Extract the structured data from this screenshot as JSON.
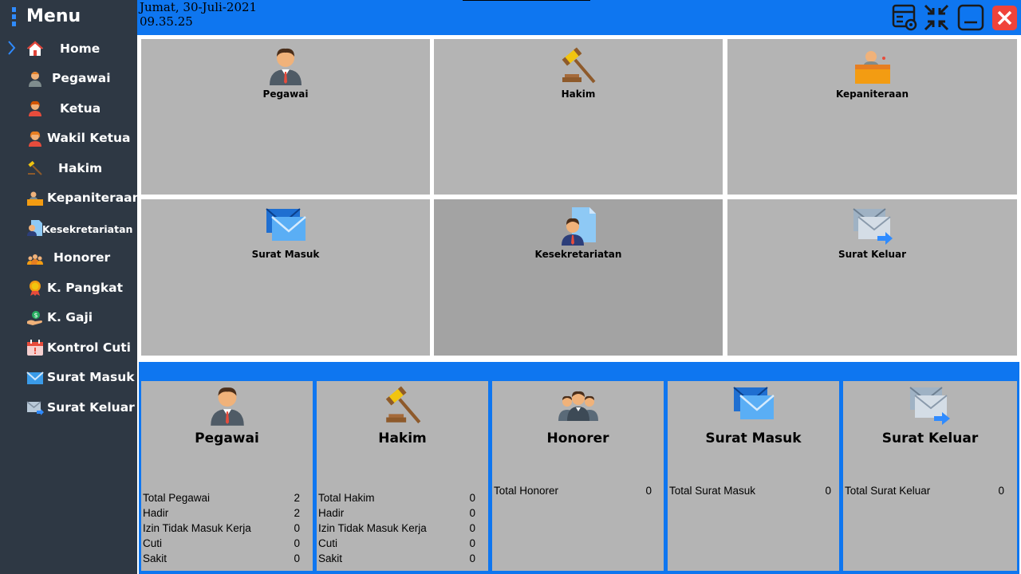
{
  "sidebar": {
    "title": "Menu",
    "items": [
      {
        "label": "Home",
        "icon": "home-icon",
        "selected": true
      },
      {
        "label": "Pegawai",
        "icon": "employee-icon"
      },
      {
        "label": "Ketua",
        "icon": "chairman-icon"
      },
      {
        "label": "Wakil Ketua",
        "icon": "vice-chairman-icon"
      },
      {
        "label": "Hakim",
        "icon": "gavel-icon"
      },
      {
        "label": "Kepaniteraan",
        "icon": "clerk-desk-icon"
      },
      {
        "label": "Kesekretariatan",
        "icon": "secretariat-icon"
      },
      {
        "label": "Honorer",
        "icon": "honorary-staff-icon"
      },
      {
        "label": "K. Pangkat",
        "icon": "rank-medal-icon"
      },
      {
        "label": "K. Gaji",
        "icon": "salary-icon"
      },
      {
        "label": "Kontrol Cuti",
        "icon": "calendar-icon"
      },
      {
        "label": "Surat Masuk",
        "icon": "incoming-mail-icon"
      },
      {
        "label": "Surat Keluar",
        "icon": "outgoing-mail-icon"
      }
    ]
  },
  "header": {
    "date": "Jumat, 30-Juli-2021",
    "time": "09.35.25",
    "buttons": [
      "settings-table-icon",
      "collapse-arrows-icon",
      "minimize-icon",
      "close-icon"
    ]
  },
  "tiles": [
    {
      "label": "Pegawai",
      "icon": "employee-icon"
    },
    {
      "label": "Hakim",
      "icon": "gavel-icon"
    },
    {
      "label": "Kepaniteraan",
      "icon": "clerk-desk-icon"
    },
    {
      "label": "Surat Masuk",
      "icon": "incoming-mail-icon"
    },
    {
      "label": "Kesekretariatan",
      "icon": "secretariat-icon"
    },
    {
      "label": "Surat Keluar",
      "icon": "outgoing-mail-icon"
    }
  ],
  "cards": [
    {
      "title": "Pegawai",
      "icon": "employee-icon",
      "stats": [
        {
          "label": "Total Pegawai",
          "value": "2"
        },
        {
          "label": "Hadir",
          "value": "2"
        },
        {
          "label": "Izin Tidak Masuk Kerja",
          "value": "0"
        },
        {
          "label": "Cuti",
          "value": "0"
        },
        {
          "label": "Sakit",
          "value": "0"
        }
      ]
    },
    {
      "title": "Hakim",
      "icon": "gavel-icon",
      "stats": [
        {
          "label": "Total Hakim",
          "value": "0"
        },
        {
          "label": "Hadir",
          "value": "0"
        },
        {
          "label": "Izin Tidak Masuk Kerja",
          "value": "0"
        },
        {
          "label": "Cuti",
          "value": "0"
        },
        {
          "label": "Sakit",
          "value": "0"
        }
      ]
    },
    {
      "title": "Honorer",
      "icon": "honorary-staff-icon",
      "stats": [
        {
          "label": "Total Honorer",
          "value": "0"
        }
      ]
    },
    {
      "title": "Surat Masuk",
      "icon": "incoming-mail-icon",
      "stats": [
        {
          "label": "Total Surat Masuk",
          "value": "0"
        }
      ]
    },
    {
      "title": "Surat Keluar",
      "icon": "outgoing-mail-icon",
      "stats": [
        {
          "label": "Total Surat Keluar",
          "value": "0"
        }
      ]
    }
  ],
  "colors": {
    "sidebar_bg": "#2e3844",
    "header_bg": "#0e76f0",
    "tile_bg": "#b4b4b4",
    "tile_selected_bg": "#a3a3a3",
    "close_btn": "#f0433a"
  }
}
